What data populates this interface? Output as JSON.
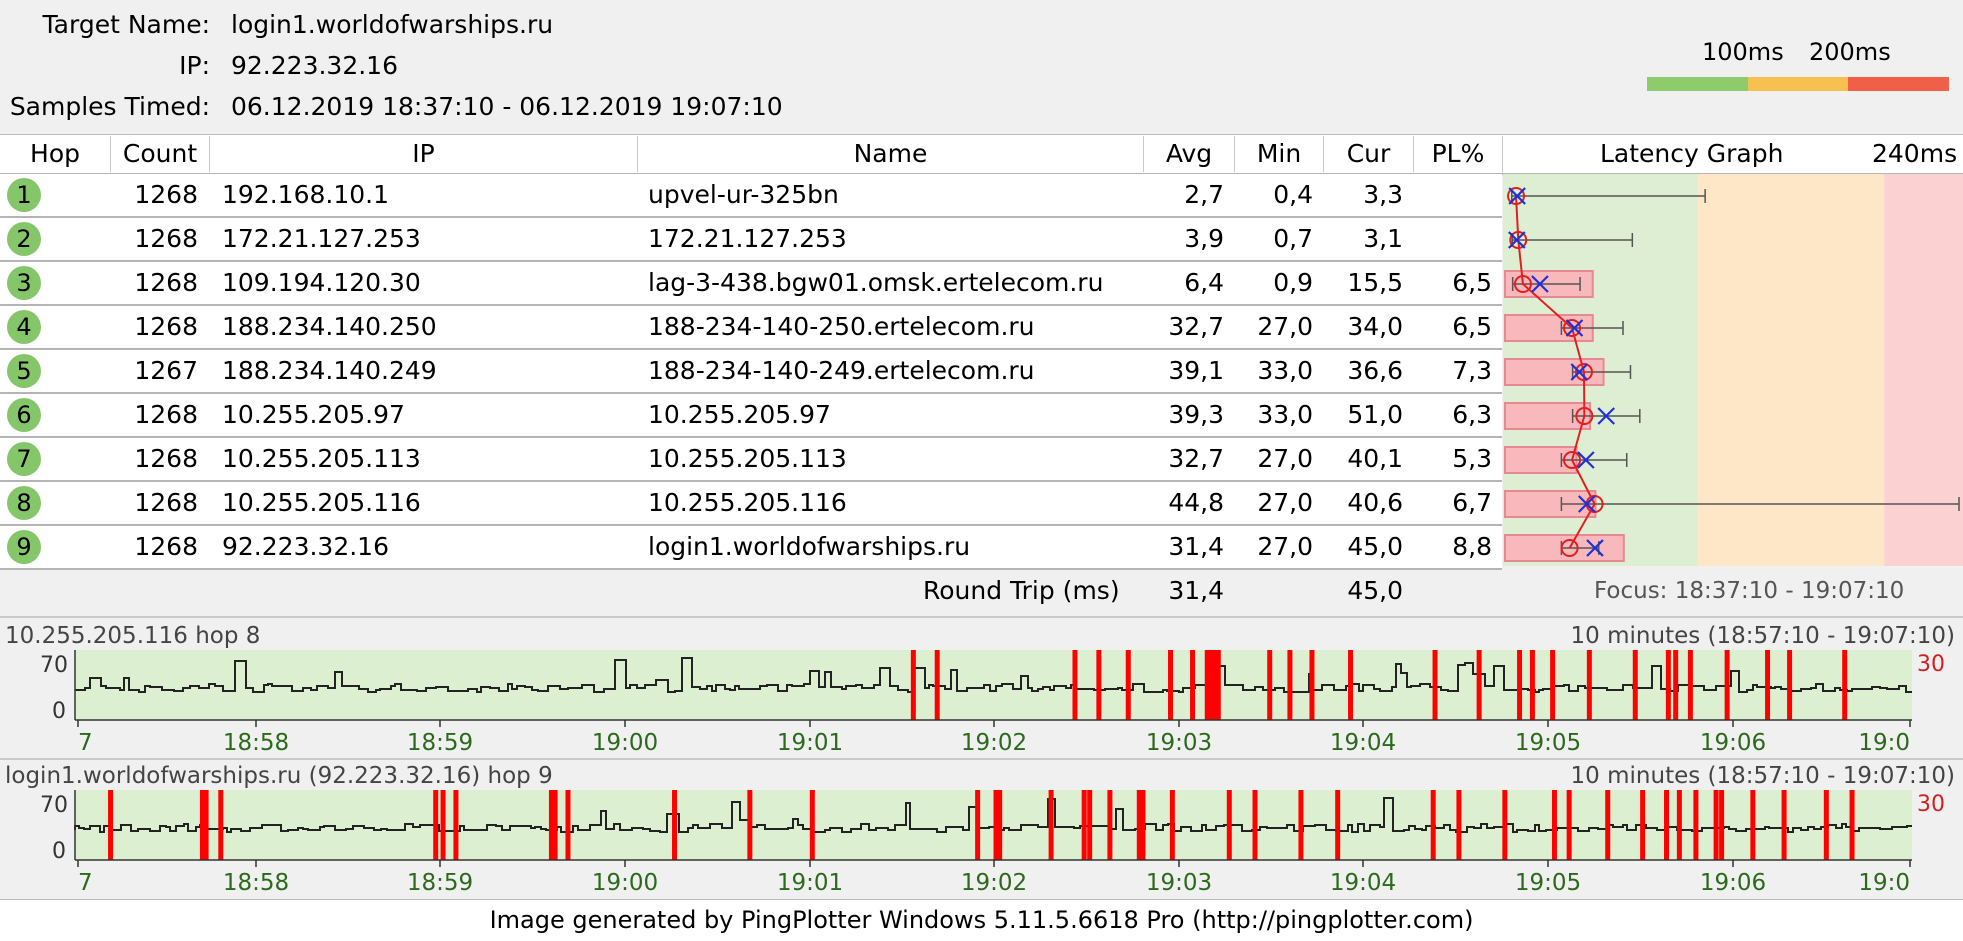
{
  "header": {
    "target_label": "Target Name:",
    "target_value": "login1.worldofwarships.ru",
    "ip_label": "IP:",
    "ip_value": "92.223.32.16",
    "samples_label": "Samples Timed:",
    "samples_value": "06.12.2019 18:37:10 - 06.12.2019 19:07:10"
  },
  "scale_legend": {
    "label_100": "100ms",
    "label_200": "200ms",
    "colors": [
      "#8ecb6a",
      "#f8c050",
      "#f06048"
    ]
  },
  "table": {
    "columns": {
      "hop": "Hop",
      "count": "Count",
      "ip": "IP",
      "name": "Name",
      "avg": "Avg",
      "min": "Min",
      "cur": "Cur",
      "pl": "PL%",
      "graph": "Latency Graph",
      "graph_max": "240ms"
    },
    "rows": [
      {
        "hop": "1",
        "count": "1268",
        "ip": "192.168.10.1",
        "name": "upvel-ur-325bn",
        "avg": "2,7",
        "min": "0,4",
        "cur": "3,3",
        "pl": ""
      },
      {
        "hop": "2",
        "count": "1268",
        "ip": "172.21.127.253",
        "name": "172.21.127.253",
        "avg": "3,9",
        "min": "0,7",
        "cur": "3,1",
        "pl": ""
      },
      {
        "hop": "3",
        "count": "1268",
        "ip": "109.194.120.30",
        "name": "lag-3-438.bgw01.omsk.ertelecom.ru",
        "avg": "6,4",
        "min": "0,9",
        "cur": "15,5",
        "pl": "6,5"
      },
      {
        "hop": "4",
        "count": "1268",
        "ip": "188.234.140.250",
        "name": "188-234-140-250.ertelecom.ru",
        "avg": "32,7",
        "min": "27,0",
        "cur": "34,0",
        "pl": "6,5"
      },
      {
        "hop": "5",
        "count": "1267",
        "ip": "188.234.140.249",
        "name": "188-234-140-249.ertelecom.ru",
        "avg": "39,1",
        "min": "33,0",
        "cur": "36,6",
        "pl": "7,3"
      },
      {
        "hop": "6",
        "count": "1268",
        "ip": "10.255.205.97",
        "name": "10.255.205.97",
        "avg": "39,3",
        "min": "33,0",
        "cur": "51,0",
        "pl": "6,3"
      },
      {
        "hop": "7",
        "count": "1268",
        "ip": "10.255.205.113",
        "name": "10.255.205.113",
        "avg": "32,7",
        "min": "27,0",
        "cur": "40,1",
        "pl": "5,3"
      },
      {
        "hop": "8",
        "count": "1268",
        "ip": "10.255.205.116",
        "name": "10.255.205.116",
        "avg": "44,8",
        "min": "27,0",
        "cur": "40,6",
        "pl": "6,7"
      },
      {
        "hop": "9",
        "count": "1268",
        "ip": "92.223.32.16",
        "name": "login1.worldofwarships.ru",
        "avg": "31,4",
        "min": "27,0",
        "cur": "45,0",
        "pl": "8,8"
      }
    ],
    "round_trip_label": "Round Trip (ms)",
    "round_trip_avg": "31,4",
    "round_trip_cur": "45,0",
    "focus_label": "Focus: 18:37:10 - 19:07:10"
  },
  "latency_graph": {
    "max_ms": 240,
    "hops": [
      {
        "avg": 2.7,
        "min": 0.4,
        "cur": 3.3,
        "max": 104,
        "pl": 0
      },
      {
        "avg": 3.9,
        "min": 0.7,
        "cur": 3.1,
        "max": 65,
        "pl": 0
      },
      {
        "avg": 6.4,
        "min": 0.9,
        "cur": 15.5,
        "max": 37,
        "pl": 6.5
      },
      {
        "avg": 32.7,
        "min": 27.0,
        "cur": 34.0,
        "max": 60,
        "pl": 6.5
      },
      {
        "avg": 39.1,
        "min": 33.0,
        "cur": 36.6,
        "max": 64,
        "pl": 7.3
      },
      {
        "avg": 39.3,
        "min": 33.0,
        "cur": 51.0,
        "max": 69,
        "pl": 6.3
      },
      {
        "avg": 32.7,
        "min": 27.0,
        "cur": 40.1,
        "max": 62,
        "pl": 5.3
      },
      {
        "avg": 44.8,
        "min": 27.0,
        "cur": 40.6,
        "max": 240,
        "pl": 6.7
      },
      {
        "avg": 31.4,
        "min": 27.0,
        "cur": 45.0,
        "max": 47,
        "pl": 8.8
      }
    ]
  },
  "mini_charts": [
    {
      "title": "10.255.205.116 hop 8",
      "range": "10 minutes (18:57:10 - 19:07:10)",
      "y_top": "70",
      "y_bottom": "0",
      "pl_scale": "30",
      "x_ticks": [
        "7",
        "18:58",
        "18:59",
        "19:00",
        "19:01",
        "19:02",
        "19:03",
        "19:04",
        "19:05",
        "19:06",
        "19:0"
      ],
      "loss_positions": [
        0.455,
        0.468,
        0.543,
        0.556,
        0.572,
        0.595,
        0.607,
        0.615,
        0.617,
        0.619,
        0.621,
        0.649,
        0.66,
        0.672,
        0.693,
        0.739,
        0.763,
        0.785,
        0.792,
        0.803,
        0.823,
        0.848,
        0.866,
        0.87,
        0.878,
        0.898,
        0.92,
        0.932,
        0.962
      ]
    },
    {
      "title": "login1.worldofwarships.ru (92.223.32.16) hop 9",
      "range": "10 minutes (18:57:10 - 19:07:10)",
      "y_top": "70",
      "y_bottom": "0",
      "pl_scale": "30",
      "x_ticks": [
        "7",
        "18:58",
        "18:59",
        "19:00",
        "19:01",
        "19:02",
        "19:03",
        "19:04",
        "19:05",
        "19:06",
        "19:0"
      ],
      "loss_positions": [
        0.018,
        0.068,
        0.07,
        0.078,
        0.195,
        0.199,
        0.206,
        0.258,
        0.26,
        0.267,
        0.325,
        0.366,
        0.4,
        0.49,
        0.5,
        0.502,
        0.53,
        0.548,
        0.551,
        0.562,
        0.578,
        0.58,
        0.596,
        0.627,
        0.641,
        0.666,
        0.686,
        0.738,
        0.752,
        0.777,
        0.804,
        0.812,
        0.833,
        0.852,
        0.865,
        0.872,
        0.881,
        0.892,
        0.895,
        0.912,
        0.929,
        0.952,
        0.966
      ]
    }
  ],
  "footer": "Image generated by PingPlotter Windows 5.11.5.6618 Pro (http://pingplotter.com)"
}
